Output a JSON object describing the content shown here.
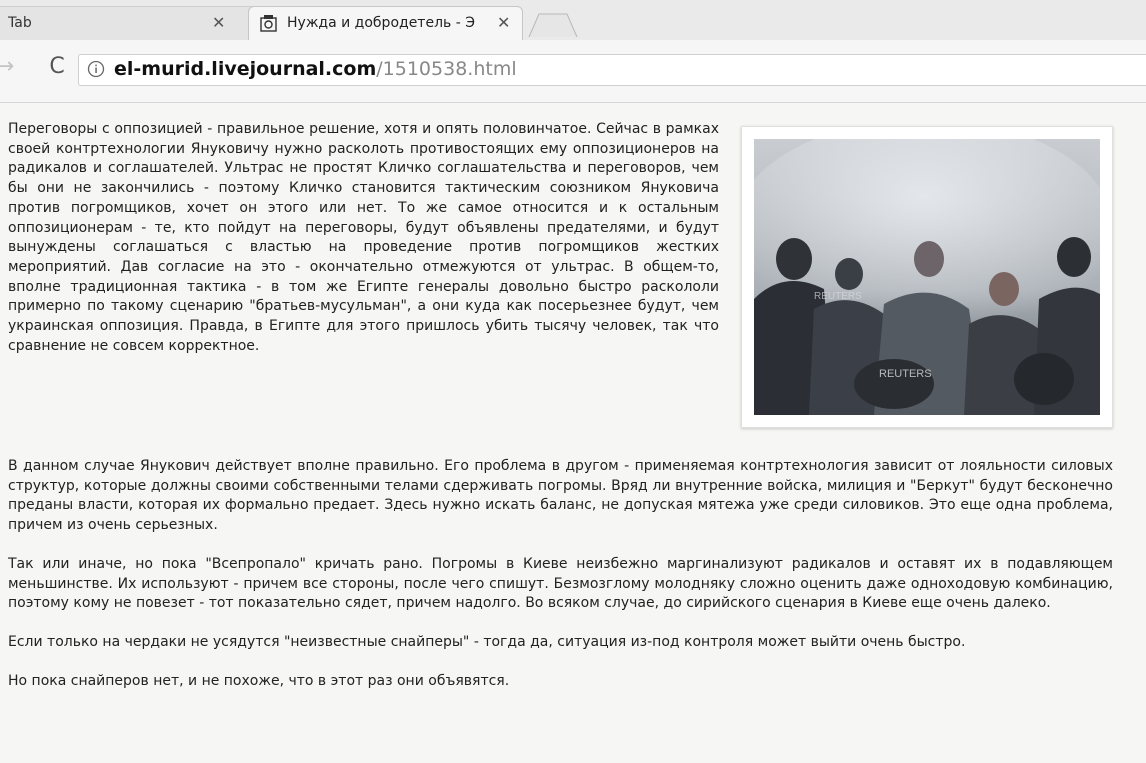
{
  "browser": {
    "tabs": [
      {
        "title": "Tab",
        "active": false
      },
      {
        "title": "Нужда и добродетель - Э",
        "active": true
      }
    ],
    "url_host": "el-murid.livejournal.com",
    "url_path": "/1510538.html"
  },
  "article": {
    "paragraphs": [
      "Переговоры с оппозицией - правильное решение, хотя и опять половинчатое. Сейчас в рамках своей контртехнологии Януковичу нужно расколоть противостоящих ему оппозиционеров на радикалов и соглашателей. Ультрас не простят Кличко соглашательства и переговоров, чем бы они не закончились - поэтому Кличко становится тактическим союзником Януковича против погромщиков, хочет он этого или нет. То же самое относится и к остальным оппозиционерам - те, кто пойдут на переговоры, будут объявлены предателями, и будут вынуждены соглашаться с властью на проведение против погромщиков жестких мероприятий. Дав согласие на это - окончательно отмежуются от ультрас. В общем-то, вполне традиционная тактика - в том же Египте генералы довольно быстро раскололи примерно по такому сценарию \"братьев-мусульман\", а они куда как посерьезнее будут, чем украинская оппозиция. Правда, в Египте для этого пришлось убить тысячу человек, так что сравнение не совсем корректное.",
      "В данном случае Янукович действует вполне правильно. Его проблема в другом - применяемая контртехнология зависит от лояльности силовых структур, которые должны своими собственными телами сдерживать погромы. Вряд ли внутренние войска, милиция и \"Беркут\" будут бесконечно преданы власти, которая их формально предает. Здесь нужно искать баланс, не допуская мятежа уже среди силовиков. Это еще одна проблема, причем из очень серьезных.",
      "Так или иначе, но пока \"Всепропало\" кричать рано. Погромы в Киеве неизбежно маргинализуют радикалов и оставят их в подавляющем меньшинстве. Их используют - причем все стороны, после чего спишут. Безмозглому молодняку сложно оценить даже одноходовую комбинацию, поэтому кому не повезет - тот показательно сядет, причем надолго. Во всяком случае, до сирийского сценария в Киеве еще очень далеко.",
      "Если только на чердаки не усядутся \"неизвестные снайперы\" - тогда да, ситуация из-под контроля может выйти очень быстро.",
      "Но пока снайперов нет, и не похоже, что в этот раз они объявятся."
    ],
    "image": {
      "watermark_1": "REUTERS",
      "watermark_2": "REUTERS"
    }
  }
}
